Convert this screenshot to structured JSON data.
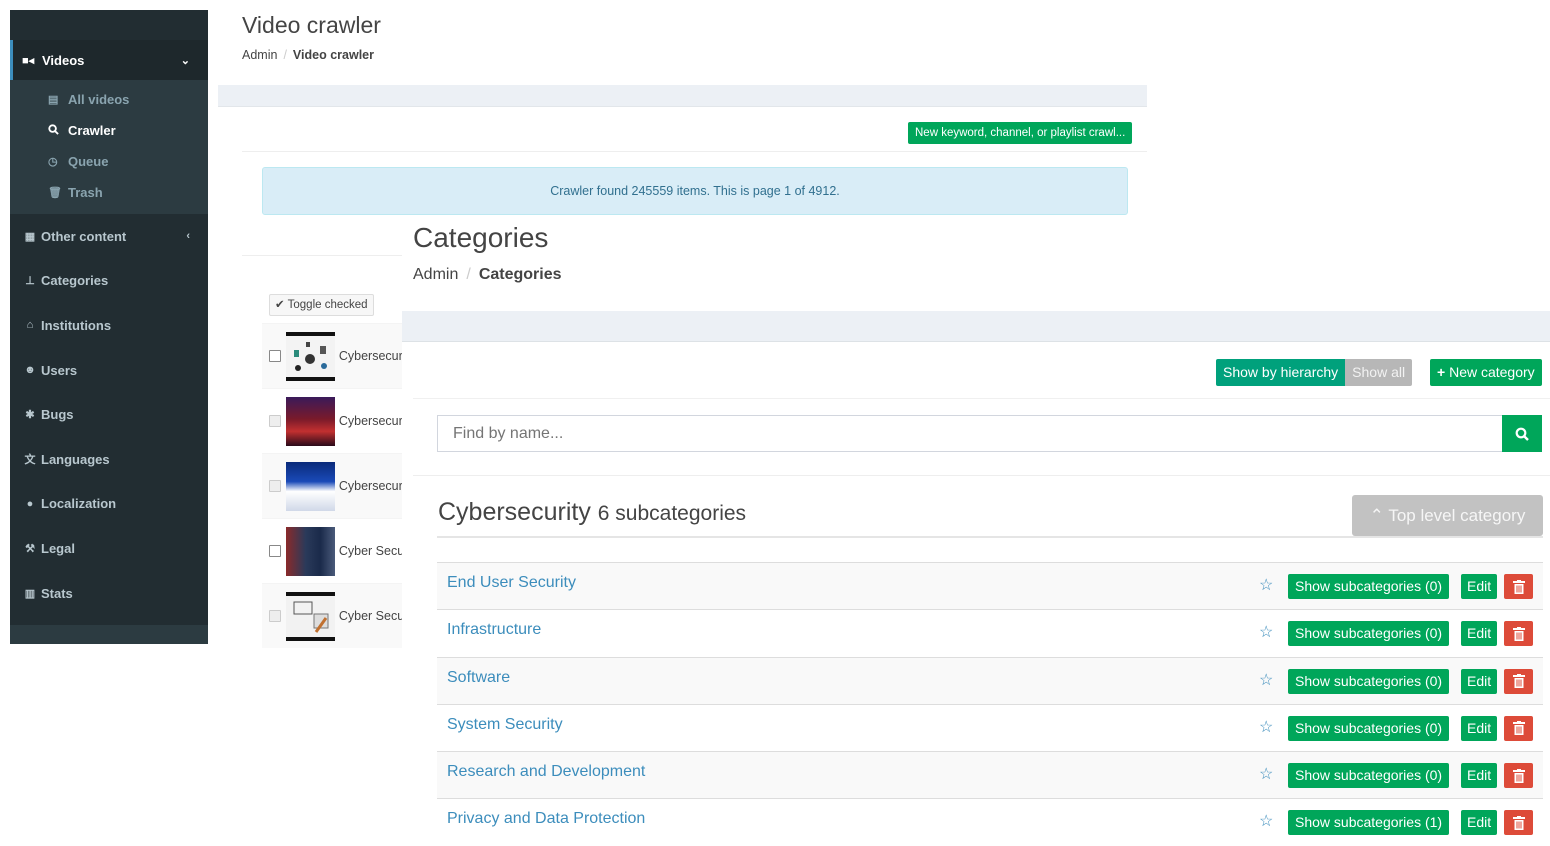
{
  "sidebar": {
    "videos": {
      "label": "Videos",
      "icon": "video-camera-icon"
    },
    "video_sub": [
      {
        "label": "All videos",
        "icon": "file-icon"
      },
      {
        "label": "Crawler",
        "icon": "search-icon",
        "active": true
      },
      {
        "label": "Queue",
        "icon": "clock-icon"
      },
      {
        "label": "Trash",
        "icon": "trash-icon"
      }
    ],
    "items": [
      {
        "label": "Other content",
        "icon": "newspaper-icon"
      },
      {
        "label": "Categories",
        "icon": "sitemap-icon"
      },
      {
        "label": "Institutions",
        "icon": "bank-icon"
      },
      {
        "label": "Users",
        "icon": "users-icon"
      },
      {
        "label": "Bugs",
        "icon": "bug-icon"
      },
      {
        "label": "Languages",
        "icon": "language-icon"
      },
      {
        "label": "Localization",
        "icon": "globe-icon"
      },
      {
        "label": "Legal",
        "icon": "gavel-icon"
      },
      {
        "label": "Stats",
        "icon": "bar-chart-icon"
      }
    ]
  },
  "crawler": {
    "title": "Video crawler",
    "breadcrumb": {
      "root": "Admin",
      "current": "Video crawler"
    },
    "new_button": "New keyword, channel, or playlist crawl...",
    "alert": "Crawler found 245559 items. This is page 1 of 4912.",
    "toggle_checked": "Toggle checked",
    "rows": [
      {
        "name": "Cybersecurity"
      },
      {
        "name": "Cybersecurity"
      },
      {
        "name": "Cybersecurity"
      },
      {
        "name": "Cyber Security"
      },
      {
        "name": "Cyber Security"
      }
    ]
  },
  "categories": {
    "title": "Categories",
    "breadcrumb": {
      "root": "Admin",
      "current": "Categories"
    },
    "show_by_hierarchy": "Show by hierarchy",
    "show_all": "Show all",
    "new_category": "New category",
    "search_placeholder": "Find by name...",
    "parent": {
      "name": "Cybersecurity",
      "subcount": "6 subcategories"
    },
    "top_level_button": "Top level category",
    "edit_label": "Edit",
    "rows": [
      {
        "name": "End User Security",
        "sub_label": "Show subcategories (0)"
      },
      {
        "name": "Infrastructure",
        "sub_label": "Show subcategories (0)"
      },
      {
        "name": "Software",
        "sub_label": "Show subcategories (0)"
      },
      {
        "name": "System Security",
        "sub_label": "Show subcategories (0)"
      },
      {
        "name": "Research and Development",
        "sub_label": "Show subcategories (0)"
      },
      {
        "name": "Privacy and Data Protection",
        "sub_label": "Show subcategories (1)"
      }
    ]
  },
  "colors": {
    "accent_green": "#00a65a",
    "link_blue": "#3c8dbc",
    "danger_red": "#dd4b39",
    "sidebar_dark": "#222d32"
  }
}
